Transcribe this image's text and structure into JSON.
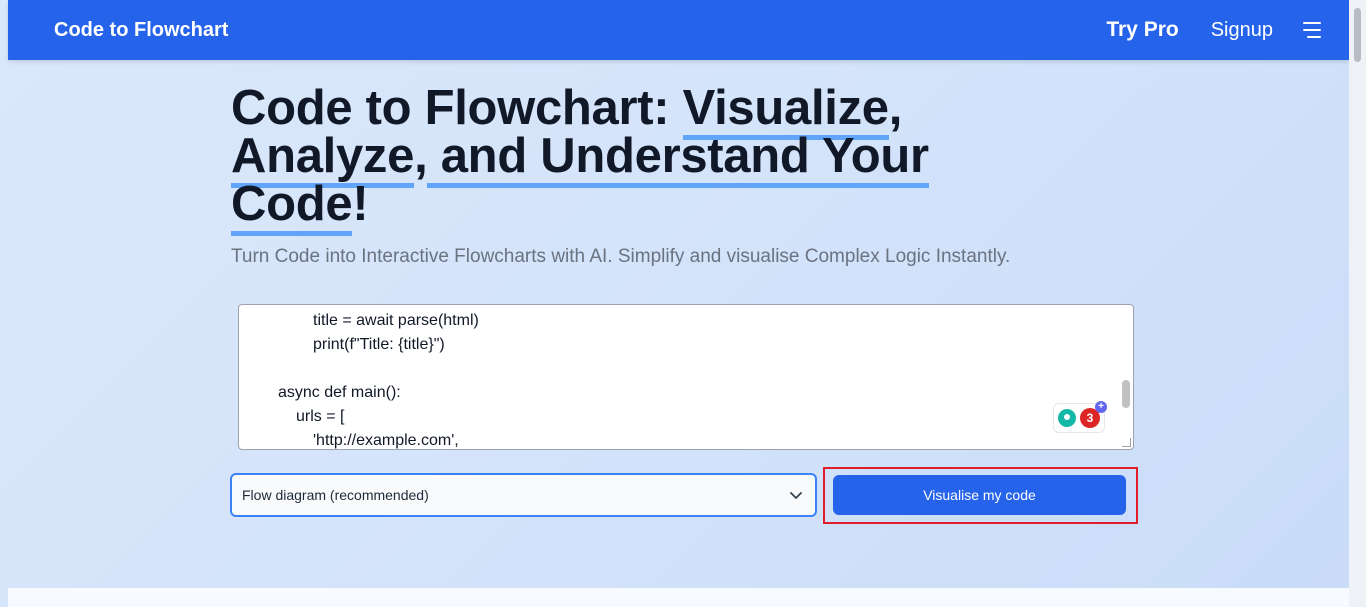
{
  "nav": {
    "brand": "Code to Flowchart",
    "try_pro": "Try Pro",
    "signup": "Signup",
    "menu_icon": "hamburger-menu-icon"
  },
  "hero": {
    "title_part1": "Code to Flowchart: ",
    "title_hl1": "Visualize",
    "title_part2": ",",
    "title_hl2": "Analyze",
    "title_part3": ",",
    "title_hl3": " and Understand Your",
    "title_hl4": "Code",
    "title_part4": "!",
    "subtitle": "Turn Code into Interactive Flowcharts with AI. Simplify and visualise Complex Logic Instantly."
  },
  "code_editor": {
    "lines": [
      "title = await parse(html)",
      "print(f\"Title: {title}\")",
      "",
      "async def main():",
      "urls = [",
      "'http://example.com',"
    ],
    "extension_badge_count": "3"
  },
  "controls": {
    "diagram_type_selected": "Flow diagram (recommended)",
    "visualise_button": "Visualise my code"
  },
  "colors": {
    "brand_blue": "#2563eb",
    "highlight_underline": "#60a5fa",
    "focus_outline_red": "#e11d2a"
  }
}
